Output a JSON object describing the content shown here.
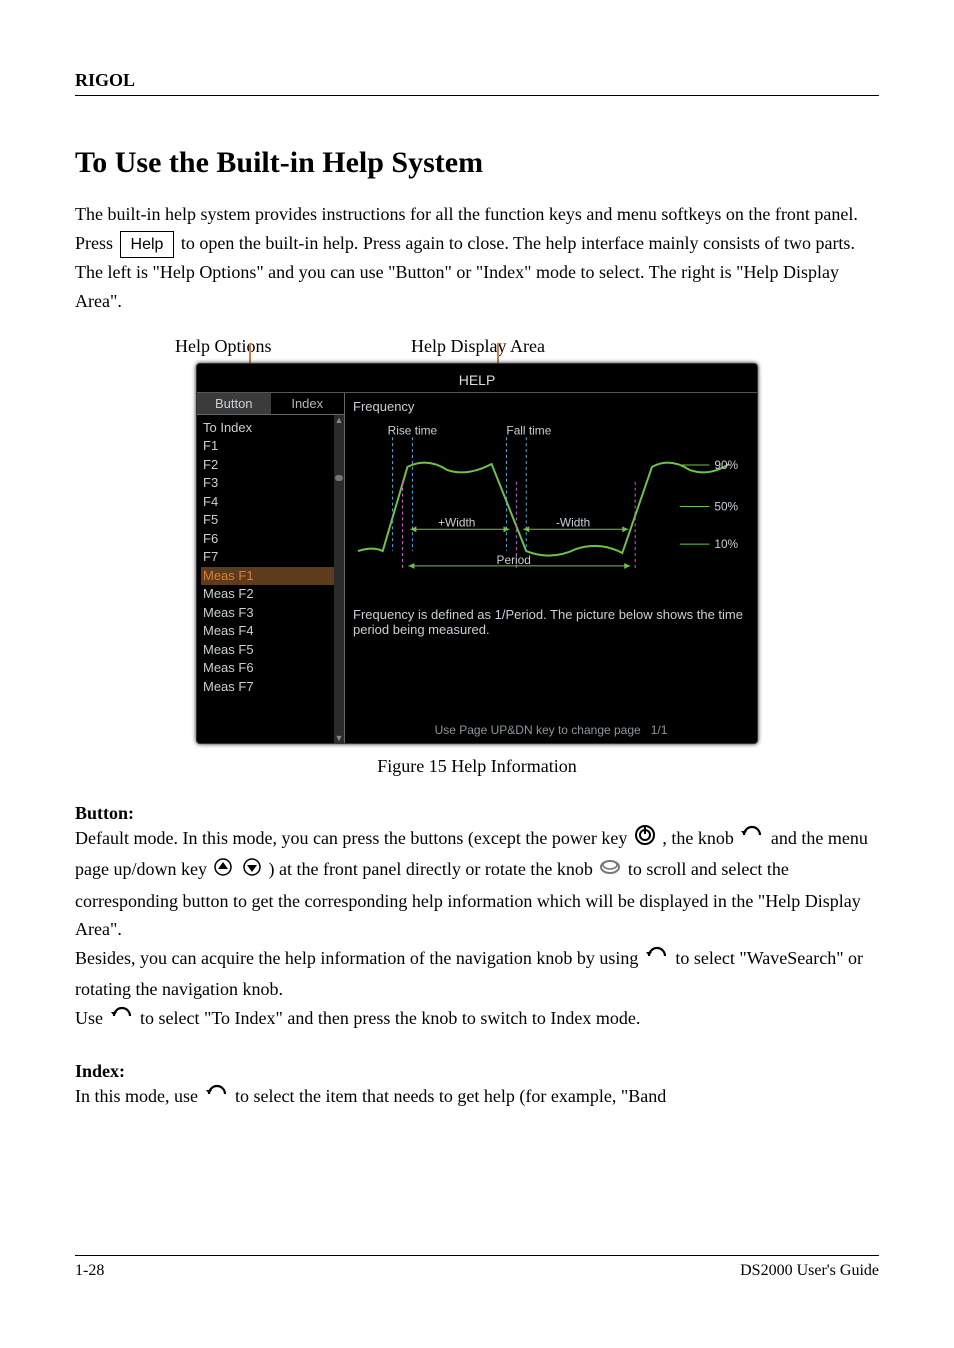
{
  "header": {
    "brand": "RIGOL"
  },
  "title": "To Use the Built-in Help System",
  "intro_parts": {
    "p1": "The built-in help system provides instructions for all the function keys and menu softkeys on the front panel. Press ",
    "keycap": "Help",
    "p2": " to open the built-in help. Press again to close. The help interface mainly consists of two parts. The left is \"Help Options\" and you can use \"Button\" or \"Index\" mode to select. The right is \"Help Display Area\"."
  },
  "callouts": {
    "left": "Help Options",
    "right": "Help Display Area"
  },
  "help_window": {
    "title": "HELP",
    "tabs": [
      "Button",
      "Index"
    ],
    "active_tab": 0,
    "items": [
      "To Index",
      "F1",
      "F2",
      "F3",
      "F4",
      "F5",
      "F6",
      "F7",
      "Meas F1",
      "Meas F2",
      "Meas F3",
      "Meas F4",
      "Meas F5",
      "Meas F6",
      "Meas F7"
    ],
    "selected_index": 8,
    "content": {
      "topic": "Frequency",
      "labels": {
        "rise": "Rise time",
        "fall": "Fall time",
        "pwidth": "+Width",
        "nwidth": "-Width",
        "period": "Period",
        "p90": "90%",
        "p50": "50%",
        "p10": "10%"
      },
      "description": "Frequency is defined as 1/Period. The picture below shows the time period being measured."
    },
    "footer": "Use Page UP&DN key to change page",
    "page_indicator": "1/1"
  },
  "chart_data": {
    "type": "line",
    "title": "Frequency (waveform timing diagram)",
    "series": [
      {
        "name": "waveform",
        "x": [
          0,
          30,
          65,
          140,
          185,
          270,
          310,
          360,
          395
        ],
        "values": [
          45,
          50,
          15,
          12,
          50,
          50,
          14,
          12,
          48
        ]
      }
    ],
    "threshold_levels": {
      "low": 10,
      "mid": 50,
      "high": 90
    },
    "annotations": [
      "Rise time",
      "Fall time",
      "+Width",
      "-Width",
      "Period",
      "90%",
      "50%",
      "10%"
    ],
    "ylim": [
      0,
      60
    ],
    "xlabel": "",
    "ylabel": ""
  },
  "figure_caption": "Figure 15 Help Information",
  "sections": {
    "button": {
      "heading": "Button:",
      "body_parts": {
        "b1": "Default mode. In this mode, you can press the buttons (except the power key ",
        "b2": ", the knob ",
        "b3": " and the menu page up/down key ",
        "b4": ") at the front panel directly or rotate the knob ",
        "b5": " to scroll and select the corresponding button to get the corresponding help information which will be displayed in the \"Help Display Area\".",
        "b6": "Besides, you can acquire the help information of the navigation knob by using ",
        "b7": " to select \"WaveSearch\" or rotating the navigation knob.",
        "b8": "Use ",
        "b9": " to select \"To Index\" and then press the knob to switch to Index mode."
      }
    },
    "index": {
      "heading": "Index:",
      "body_parts": {
        "b1": "In this mode, use ",
        "b2": " to select the item that needs to get help (for example, \"Band"
      }
    }
  },
  "footer": {
    "page": "1-28",
    "doc": "DS2000 User's Guide"
  },
  "icons": {
    "power": "power-icon",
    "knob": "knob-icon",
    "page_up": "page-up-icon",
    "page_down": "page-down-icon",
    "nav_knob": "nav-knob-icon"
  }
}
